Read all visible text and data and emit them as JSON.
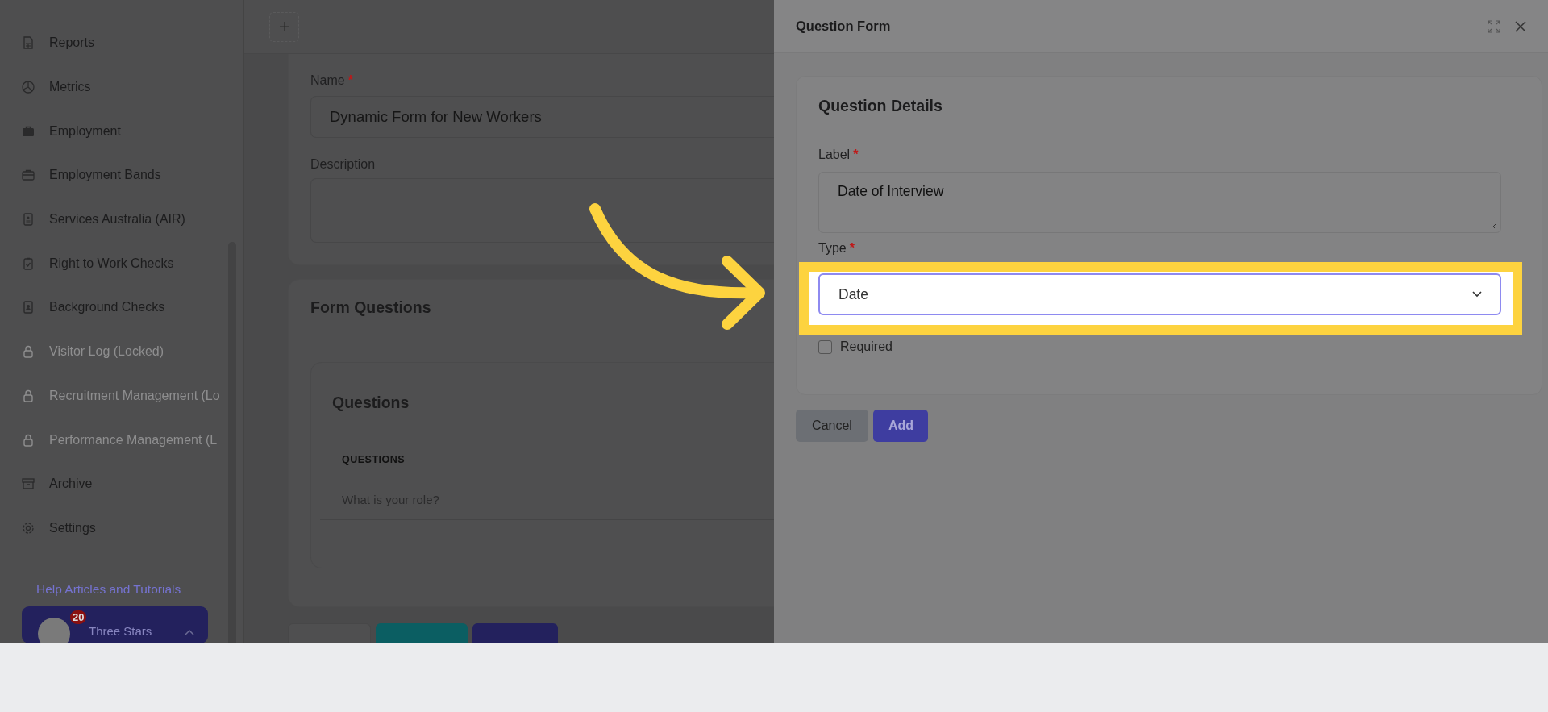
{
  "sidebar": {
    "items": [
      {
        "label": "Reports",
        "disabled": false
      },
      {
        "label": "Metrics",
        "disabled": false
      },
      {
        "label": "Employment",
        "disabled": false
      },
      {
        "label": "Employment Bands",
        "disabled": false
      },
      {
        "label": "Services Australia (AIR)",
        "disabled": false
      },
      {
        "label": "Right to Work Checks",
        "disabled": false
      },
      {
        "label": "Background Checks",
        "disabled": false
      },
      {
        "label": "Visitor Log (Locked)",
        "disabled": true
      },
      {
        "label": "Recruitment Management (Lo",
        "disabled": true
      },
      {
        "label": "Performance Management (L",
        "disabled": true
      },
      {
        "label": "Archive",
        "disabled": false
      },
      {
        "label": "Settings",
        "disabled": false
      }
    ],
    "help_link": "Help Articles and Tutorials",
    "account": {
      "badge": "20",
      "name": "Three Stars"
    }
  },
  "form": {
    "name": {
      "label": "Name",
      "required_mark": "*",
      "value": "Dynamic Form for New Workers"
    },
    "description": {
      "label": "Description"
    },
    "questions_section": {
      "title": "Form Questions",
      "card_title": "Questions",
      "column": "QUESTIONS",
      "rows": [
        "What is your role?"
      ]
    }
  },
  "drawer": {
    "title": "Question Form",
    "section_title": "Question Details",
    "label_field": {
      "label": "Label",
      "required_mark": "*",
      "value": "Date of Interview"
    },
    "type_field": {
      "label": "Type",
      "required_mark": "*",
      "value": "Date",
      "highlighted": true
    },
    "required_checkbox": {
      "label": "Required",
      "checked": false
    },
    "buttons": [
      {
        "label": "Cancel",
        "kind": "secondary"
      },
      {
        "label": "Add",
        "kind": "primary"
      }
    ]
  }
}
